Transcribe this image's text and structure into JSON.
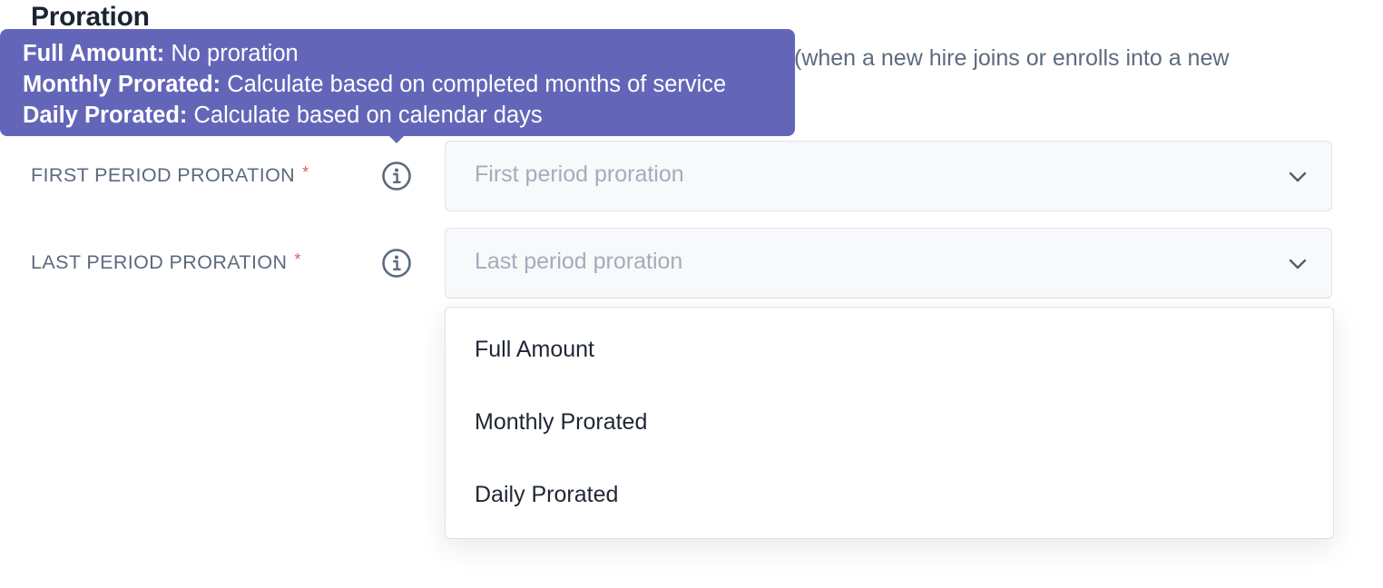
{
  "section": {
    "title": "Proration",
    "description_visible": "(when a new hire joins or enrolls into a new"
  },
  "tooltip": {
    "lines": [
      {
        "term": "Full Amount:",
        "desc": "No proration"
      },
      {
        "term": "Monthly Prorated:",
        "desc": "Calculate based on completed months of service"
      },
      {
        "term": "Daily Prorated:",
        "desc": "Calculate based on calendar days"
      }
    ]
  },
  "fields": {
    "first": {
      "label": "FIRST PERIOD PRORATION",
      "required_mark": "*",
      "placeholder": "First period proration"
    },
    "last": {
      "label": "LAST PERIOD PRORATION",
      "required_mark": "*",
      "placeholder": "Last period proration"
    }
  },
  "dropdown": {
    "options": [
      "Full Amount",
      "Monthly Prorated",
      "Daily Prorated"
    ]
  },
  "icons": {
    "info": "info-icon",
    "chevron": "chevron-down-icon"
  },
  "colors": {
    "tooltip_bg": "#6366b8",
    "required": "#e05a5a",
    "label": "#5b6a7e",
    "placeholder": "#a3adba"
  }
}
